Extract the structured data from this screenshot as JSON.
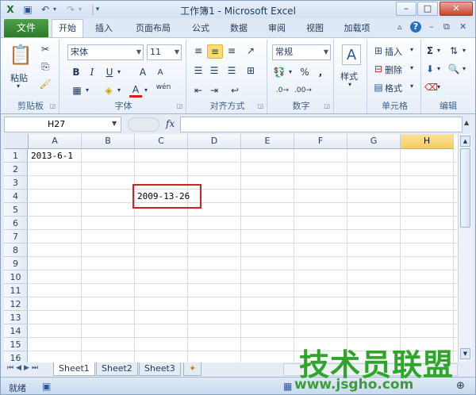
{
  "window": {
    "title": "工作簿1 - Microsoft Excel",
    "controls": {
      "minimize": "–",
      "maximize": "□",
      "close": "✕"
    }
  },
  "ribbon_tabs": {
    "file": "文件",
    "tabs": [
      "开始",
      "插入",
      "页面布局",
      "公式",
      "数据",
      "审阅",
      "视图",
      "加载项"
    ],
    "active": "开始"
  },
  "ribbon": {
    "clipboard": {
      "paste_label": "粘贴",
      "group_label": "剪贴板"
    },
    "font": {
      "font_name": "宋体",
      "font_size": "11",
      "bold": "B",
      "italic": "I",
      "underline": "U",
      "wen": "wén",
      "grow": "A",
      "shrink": "A",
      "group_label": "字体"
    },
    "alignment": {
      "group_label": "对齐方式"
    },
    "number": {
      "format": "常规",
      "percent": "%",
      "comma": ",",
      "group_label": "数字"
    },
    "styles": {
      "styles_label": "样式",
      "group_label": ""
    },
    "cells": {
      "insert": "插入",
      "delete": "删除",
      "format": "格式",
      "group_label": "单元格"
    },
    "editing": {
      "sum": "Σ",
      "group_label": "编辑"
    }
  },
  "formula_bar": {
    "name_box": "H27",
    "fx": "fx",
    "formula": ""
  },
  "sheet": {
    "columns": [
      "A",
      "B",
      "C",
      "D",
      "E",
      "F",
      "G",
      "H"
    ],
    "selected_column": "H",
    "rows": [
      "1",
      "2",
      "3",
      "4",
      "5",
      "6",
      "7",
      "8",
      "9",
      "10",
      "11",
      "12",
      "13",
      "14",
      "15",
      "16"
    ],
    "cells": {
      "A1": "2013-6-1",
      "C4": "2009-13-26"
    }
  },
  "sheet_tabs": [
    "Sheet1",
    "Sheet2",
    "Sheet3"
  ],
  "active_sheet": "Sheet1",
  "status": {
    "ready": "就绪"
  },
  "watermark": {
    "text": "技术员联盟",
    "url": "www.jsgho.com"
  },
  "colors": {
    "highlight_border": "#d32020",
    "file_tab": "#2b7a2b",
    "watermark": "#2fa52a"
  }
}
